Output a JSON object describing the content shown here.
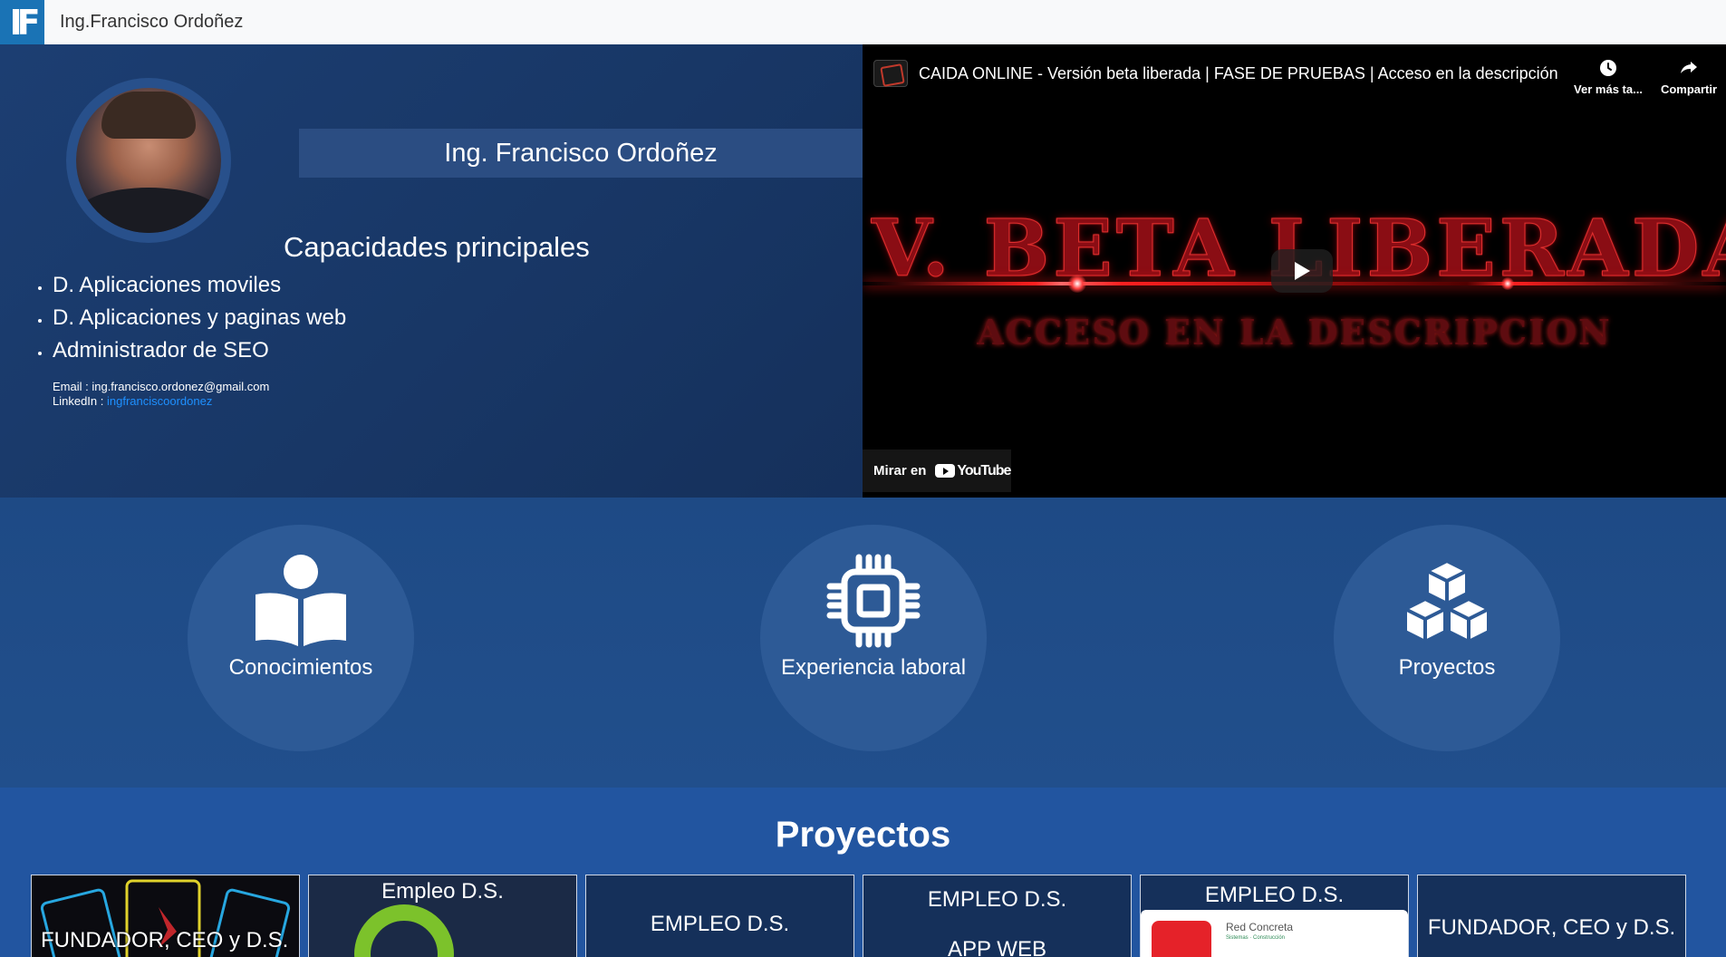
{
  "navbar": {
    "logo_text": "IF",
    "brand": "Ing.Francisco Ordoñez"
  },
  "hero": {
    "name": "Ing. Francisco Ordoñez",
    "skills_title": "Capacidades principales",
    "skills": [
      "D. Aplicaciones moviles",
      "D. Aplicaciones y paginas web",
      "Administrador de SEO"
    ],
    "email_label": "Email : ing.francisco.ordonez@gmail.com",
    "linkedin_label": "LinkedIn : ",
    "linkedin_link": "ingfranciscoordonez"
  },
  "video": {
    "title": "CAIDA ONLINE - Versión beta liberada | FASE DE PRUEBAS | Acceso en la descripción",
    "watch_later": "Ver más ta...",
    "share": "Compartir",
    "thumbnail_main": "V. BETA LIBERADA",
    "thumbnail_sub": "ACCESO EN LA DESCRIPCION",
    "watch_on": "Mirar en",
    "youtube": "YouTube"
  },
  "features": [
    {
      "label": "Conocimientos",
      "icon": "book-reader-icon"
    },
    {
      "label": "Experiencia laboral",
      "icon": "microchip-icon"
    },
    {
      "label": "Proyectos",
      "icon": "cubes-icon"
    }
  ],
  "projects": {
    "title": "Proyectos",
    "cards": [
      {
        "label": "FUNDADOR, CEO y D.S."
      },
      {
        "label": "Empleo D.S."
      },
      {
        "label": "EMPLEO D.S."
      },
      {
        "label": "EMPLEO D.S.",
        "sublabel": "APP WEB"
      },
      {
        "label": "EMPLEO D.S.",
        "app_name": "Red Concreta",
        "app_sub": "Sistemas · Construcción"
      },
      {
        "label": "FUNDADOR, CEO y D.S."
      }
    ]
  },
  "colors": {
    "accent": "#1a73b5",
    "hero_bg": "#183766",
    "section_bg": "#1e4a85",
    "circle_bg": "#2d5a96",
    "link": "#1e90ff",
    "thumb_red": "#8a0d14"
  }
}
